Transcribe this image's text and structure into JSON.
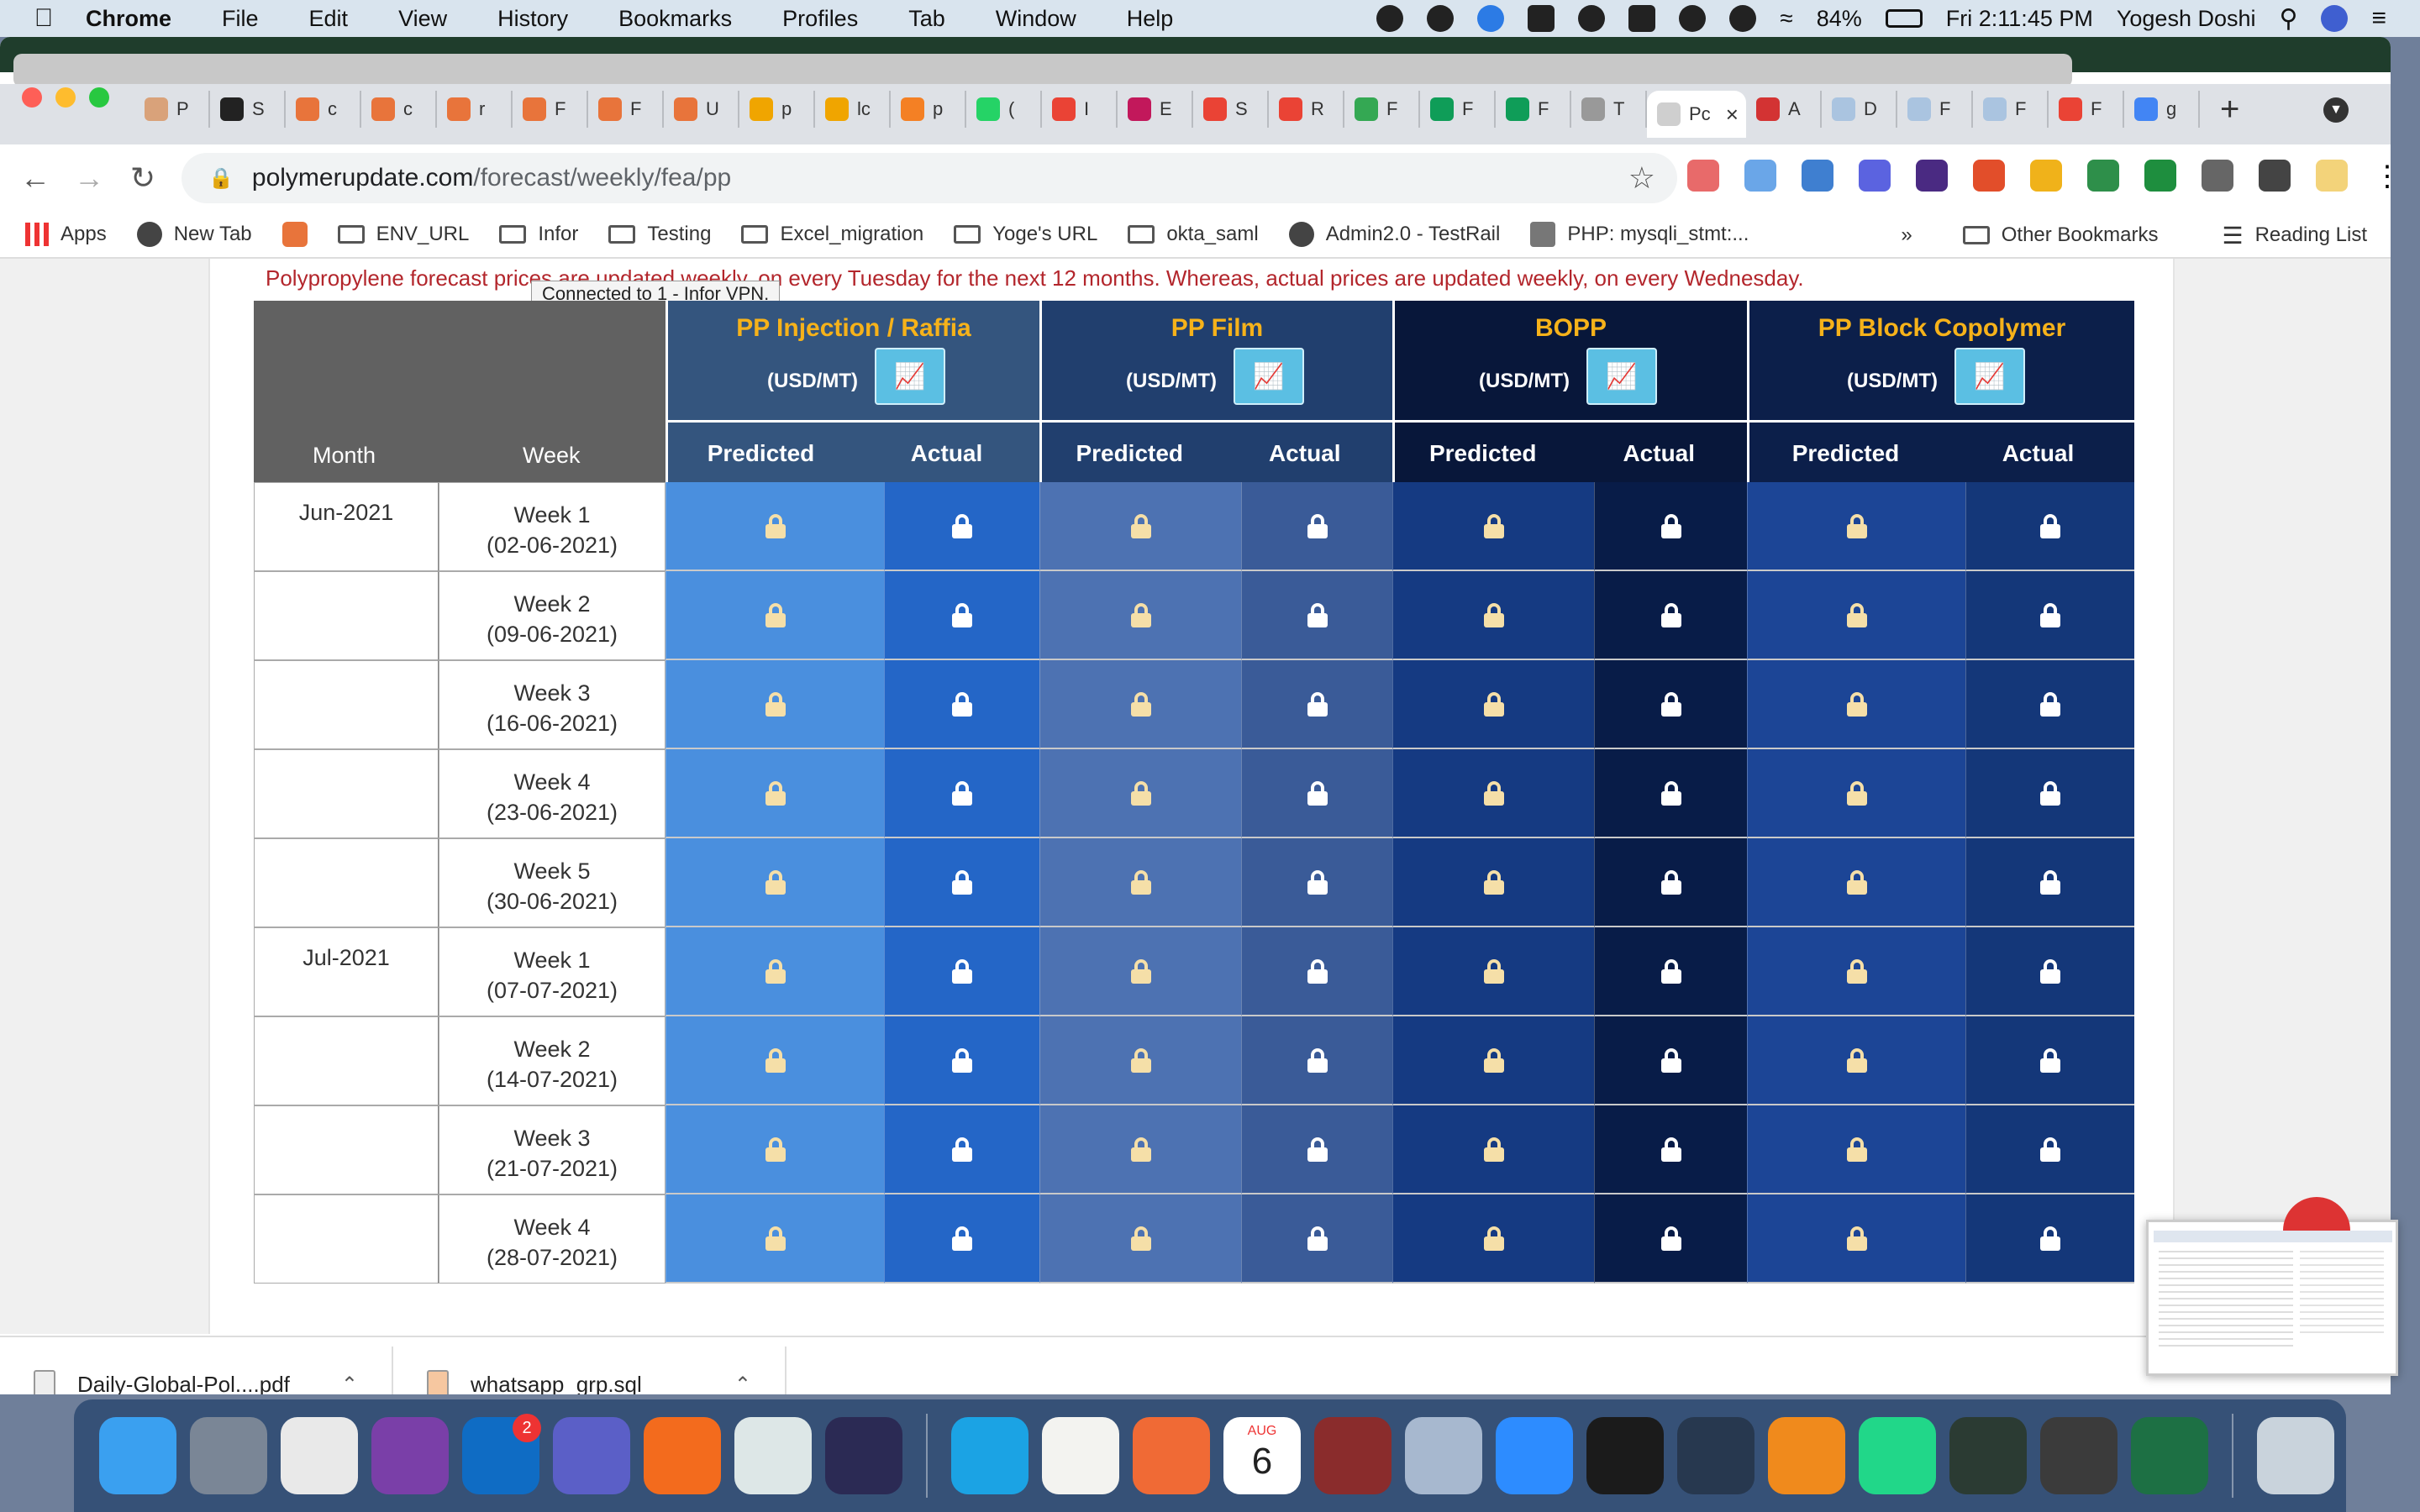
{
  "menubar": {
    "app": "Chrome",
    "items": [
      "File",
      "Edit",
      "View",
      "History",
      "Bookmarks",
      "Profiles",
      "Tab",
      "Window",
      "Help"
    ],
    "battery": "84%",
    "clock": "Fri 2:11:45 PM",
    "user": "Yogesh Doshi"
  },
  "tabs": [
    {
      "label": "P",
      "color": "#d9a27a"
    },
    {
      "label": "S",
      "color": "#222222"
    },
    {
      "label": "c",
      "color": "#e8743b"
    },
    {
      "label": "c",
      "color": "#e8743b"
    },
    {
      "label": "r",
      "color": "#e8743b"
    },
    {
      "label": "F",
      "color": "#e8743b"
    },
    {
      "label": "F",
      "color": "#e8743b"
    },
    {
      "label": "U",
      "color": "#e8743b"
    },
    {
      "label": "p",
      "color": "#f0a500"
    },
    {
      "label": "lc",
      "color": "#f0a500"
    },
    {
      "label": "p",
      "color": "#f48024"
    },
    {
      "label": "(",
      "color": "#25d366"
    },
    {
      "label": "I",
      "color": "#ea4335"
    },
    {
      "label": "E",
      "color": "#c2185b"
    },
    {
      "label": "S",
      "color": "#ea4335"
    },
    {
      "label": "R",
      "color": "#ea4335"
    },
    {
      "label": "F",
      "color": "#34a853"
    },
    {
      "label": "F",
      "color": "#0f9d58"
    },
    {
      "label": "F",
      "color": "#0f9d58"
    },
    {
      "label": "T",
      "color": "#999999"
    }
  ],
  "active_tab": {
    "label": "Pc",
    "close": "×"
  },
  "tabs_after": [
    {
      "label": "A",
      "color": "#d33333"
    },
    {
      "label": "D",
      "color": "#aac4e0"
    },
    {
      "label": "F",
      "color": "#aac4e0"
    },
    {
      "label": "F",
      "color": "#aac4e0"
    },
    {
      "label": "F",
      "color": "#ea4335"
    },
    {
      "label": "g",
      "color": "#4285f4"
    }
  ],
  "omnibox": {
    "domain": "polymerupdate.com",
    "path": "/forecast/weekly/fea/pp"
  },
  "bookmarks": [
    {
      "label": "Apps",
      "kind": "apps"
    },
    {
      "label": "New Tab",
      "kind": "globe"
    },
    {
      "label": "",
      "kind": "cp"
    },
    {
      "label": "ENV_URL",
      "kind": "folder"
    },
    {
      "label": "Infor",
      "kind": "folder"
    },
    {
      "label": "Testing",
      "kind": "folder"
    },
    {
      "label": "Excel_migration",
      "kind": "folder"
    },
    {
      "label": "Yoge's URL",
      "kind": "folder"
    },
    {
      "label": "okta_saml",
      "kind": "folder"
    },
    {
      "label": "Admin2.0 - TestRail",
      "kind": "globe"
    },
    {
      "label": "PHP: mysqli_stmt:...",
      "kind": "php"
    }
  ],
  "bookmarks_more": "»",
  "other_bookmarks": "Other Bookmarks",
  "reading_list": "Reading List",
  "notice": "Polypropylene forecast prices are updated weekly, on every Tuesday for the next 12 months. Whereas, actual prices are updated weekly, on every Wednesday.",
  "tooltip": "Connected to 1 - Infor VPN.",
  "table": {
    "month_header": "Month",
    "week_header": "Week",
    "groups": [
      {
        "title": "PP Injection / Raffia",
        "unit": "(USD/MT)",
        "predicted": "Predicted",
        "actual": "Actual",
        "hdr_color": "#34557e",
        "pred_color": "#4a8fde",
        "act_color": "#2466c7"
      },
      {
        "title": "PP Film",
        "unit": "(USD/MT)",
        "predicted": "Predicted",
        "actual": "Actual",
        "hdr_color": "#213f6e",
        "pred_color": "#4d72b2",
        "act_color": "#3a5b98"
      },
      {
        "title": "BOPP",
        "unit": "(USD/MT)",
        "predicted": "Predicted",
        "actual": "Actual",
        "hdr_color": "#08173a",
        "pred_color": "#153a82",
        "act_color": "#081c48"
      },
      {
        "title": "PP Block Copolymer",
        "unit": "(USD/MT)",
        "predicted": "Predicted",
        "actual": "Actual",
        "hdr_color": "#0c1f4a",
        "pred_color": "#1c4596",
        "act_color": "#143779"
      }
    ],
    "rows": [
      {
        "month": "Jun-2021",
        "week": "Week 1",
        "date": "(02-06-2021)"
      },
      {
        "month": "",
        "week": "Week 2",
        "date": "(09-06-2021)"
      },
      {
        "month": "",
        "week": "Week 3",
        "date": "(16-06-2021)"
      },
      {
        "month": "",
        "week": "Week 4",
        "date": "(23-06-2021)"
      },
      {
        "month": "",
        "week": "Week 5",
        "date": "(30-06-2021)"
      },
      {
        "month": "Jul-2021",
        "week": "Week 1",
        "date": "(07-07-2021)"
      },
      {
        "month": "",
        "week": "Week 2",
        "date": "(14-07-2021)"
      },
      {
        "month": "",
        "week": "Week 3",
        "date": "(21-07-2021)"
      },
      {
        "month": "",
        "week": "Week 4",
        "date": "(28-07-2021)"
      }
    ]
  },
  "downloads": [
    {
      "name": "Daily-Global-Pol....pdf"
    },
    {
      "name": "whatsapp_grp.sql"
    }
  ],
  "dock": [
    {
      "name": "finder-icon",
      "color": "#3aa0f0"
    },
    {
      "name": "launchpad-icon",
      "color": "#7a8696"
    },
    {
      "name": "chrome-icon",
      "color": "#e9e9e9"
    },
    {
      "name": "onenote-icon",
      "color": "#7a3fa8"
    },
    {
      "name": "outlook-icon",
      "color": "#0f6cc4",
      "badge": "2"
    },
    {
      "name": "teams-icon",
      "color": "#5b5fc7"
    },
    {
      "name": "firefox-icon",
      "color": "#f36b1d"
    },
    {
      "name": "vpn-icon",
      "color": "#dde7e7"
    },
    {
      "name": "eclipse-icon",
      "color": "#2b2a54"
    },
    {
      "sep": true
    },
    {
      "name": "skype-icon",
      "color": "#1ba3e4"
    },
    {
      "name": "textedit-icon",
      "color": "#f3f3f0"
    },
    {
      "name": "postman-icon",
      "color": "#f06a35"
    },
    {
      "name": "calendar-icon",
      "color": "#ffffff",
      "month": "AUG",
      "day": "6"
    },
    {
      "name": "dictionary-icon",
      "color": "#8a2c2c"
    },
    {
      "name": "preview-icon",
      "color": "#a7b8cf"
    },
    {
      "name": "zoom-icon",
      "color": "#2d8cff"
    },
    {
      "name": "terminal-icon",
      "color": "#1b1b1b"
    },
    {
      "name": "quicktime-icon",
      "color": "#27384f"
    },
    {
      "name": "vlc-icon",
      "color": "#f08a1c"
    },
    {
      "name": "pycharm-icon",
      "color": "#21d789"
    },
    {
      "name": "activity-monitor-icon",
      "color": "#2b3b33"
    },
    {
      "name": "sublime-icon",
      "color": "#3b3b3b"
    },
    {
      "name": "excel-icon",
      "color": "#1d7044"
    },
    {
      "sep": true
    },
    {
      "name": "trash-icon",
      "color": "#c9d3dc"
    }
  ]
}
